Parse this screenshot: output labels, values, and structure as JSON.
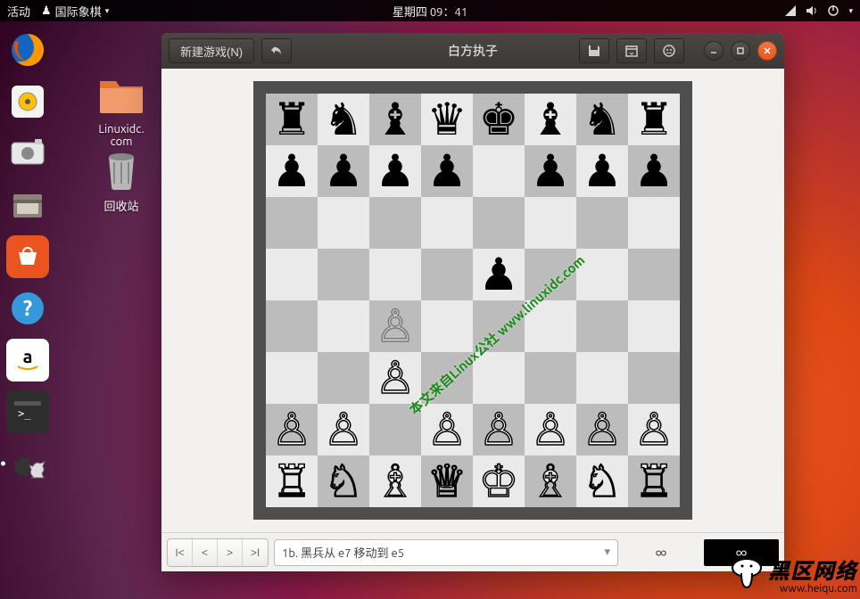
{
  "topbar": {
    "activities": "活动",
    "app": "国际象棋",
    "clock": "星期四 09：41"
  },
  "desktop": {
    "linuxidc": "Linuxidc.\ncom",
    "trash": "回收站"
  },
  "window": {
    "new_game": "新建游戏(N)",
    "title": "白方执子"
  },
  "bottom": {
    "move": "1b. 黑兵从 e7 移动到 e5",
    "clock_w": "∞",
    "clock_b": "∞"
  },
  "chart_data": {
    "type": "chess-board",
    "turn": "white",
    "last_move": {
      "from": "e7",
      "to": "e5"
    },
    "ghost": "c4",
    "position": {
      "a8": "r",
      "b8": "n",
      "c8": "b",
      "d8": "q",
      "e8": "k",
      "f8": "b",
      "g8": "n",
      "h8": "r",
      "a7": "p",
      "b7": "p",
      "c7": "p",
      "d7": "p",
      "f7": "p",
      "g7": "p",
      "h7": "p",
      "e5": "p",
      "c3": "P",
      "a2": "P",
      "b2": "P",
      "d2": "P",
      "e2": "P",
      "f2": "P",
      "g2": "P",
      "h2": "P",
      "a1": "R",
      "b1": "N",
      "c1": "B",
      "d1": "Q",
      "e1": "K",
      "f1": "B",
      "g1": "N",
      "h1": "R"
    }
  },
  "watermark": "本文来自Linux公社 www.linuxidc.com",
  "heiqu": {
    "cn": "黑区网络",
    "en": "www.heiqu.com"
  }
}
